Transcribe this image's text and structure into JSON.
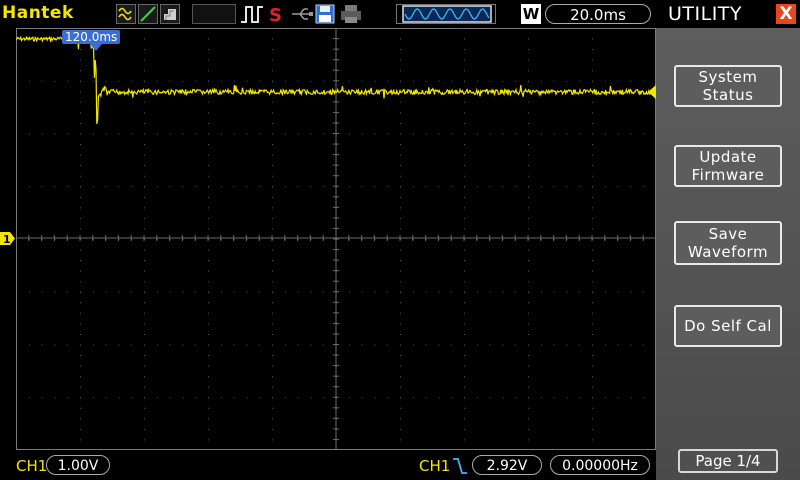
{
  "topbar": {
    "brand": "Hantek",
    "timebase": "20.0ms",
    "window_badge": "W",
    "run_state_icon": "stop-s-icon"
  },
  "screen": {
    "trigger_position_label": "120.0ms",
    "trace_color": "#f3e600",
    "channel_marker": "1"
  },
  "bottombar": {
    "ch1_label": "CH1",
    "ch1_scale": "1.00V",
    "trig_source_label": "CH1",
    "trig_slope_icon": "falling-edge-icon",
    "trig_level": "2.92V",
    "frequency": "0.00000Hz"
  },
  "panel": {
    "title": "UTILITY",
    "close_label": "X",
    "buttons": [
      {
        "line1": "System",
        "line2": "Status"
      },
      {
        "line1": "Update",
        "line2": "Firmware"
      },
      {
        "line1": "Save",
        "line2": "Waveform"
      },
      {
        "line1": "Do Self Cal",
        "line2": ""
      }
    ],
    "page_label": "Page 1/4"
  }
}
